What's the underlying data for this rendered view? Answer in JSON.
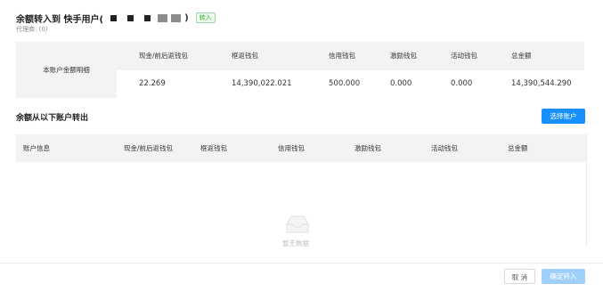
{
  "dialog": {
    "title": "余额转入到 快手用户(",
    "title_close": ")",
    "tag": "转入",
    "subtitle": "代理商: (0)"
  },
  "summary": {
    "row_label": "本账户金额明细",
    "columns": [
      "现金/前后返钱包",
      "框返钱包",
      "信用钱包",
      "激励钱包",
      "活动钱包",
      "总金额"
    ],
    "values": [
      "22.269",
      "14,390,022.021",
      "500.000",
      "0.000",
      "0.000",
      "14,390,544.290"
    ]
  },
  "transfer": {
    "section_title": "余额从以下账户转出",
    "select_button": "选择账户",
    "columns": [
      "账户信息",
      "现金/前后返钱包",
      "框返钱包",
      "信用钱包",
      "激励钱包",
      "活动钱包",
      "总金额"
    ],
    "empty_text": "暂无数据"
  },
  "footer": {
    "cancel": "取 消",
    "confirm": "确定转入"
  },
  "colors": {
    "primary": "#1890ff",
    "primary_disabled": "#9fd0fb",
    "header_bg": "#f2f3f5",
    "tag_green": "#3aa63a"
  }
}
